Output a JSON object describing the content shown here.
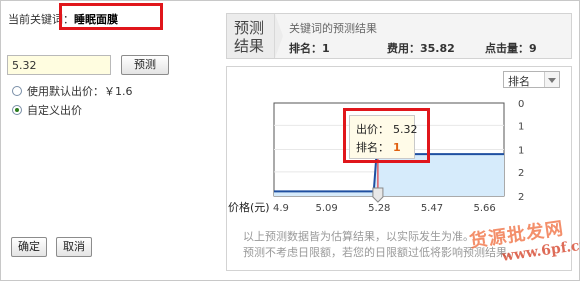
{
  "keyword_label": "当前关键词：",
  "keyword_value": "睡眠面膜",
  "bid": {
    "value": "5.32",
    "predict_button": "预测",
    "default_bid_option": "使用默认出价：￥1.6",
    "custom_bid_option": "自定义出价",
    "selected_option": "custom"
  },
  "actions": {
    "confirm": "确定",
    "cancel": "取消"
  },
  "result": {
    "tab_label_line1": "预测",
    "tab_label_line2": "结果",
    "title": "关键词的预测结果",
    "rank_label": "排名：1",
    "cost_label": "费用：35.82",
    "clicks_label": "点击量：9"
  },
  "chart_select": {
    "selected": "排名"
  },
  "tooltip": {
    "price_label": "出价：",
    "price_value": "5.32",
    "rank_label": "排名：",
    "rank_value": "1"
  },
  "note": {
    "line1": "以上预测数据皆为估算结果，以实际发生为准。",
    "line2": "预测不考虑日限额，若您的日限额过低将影响预测结果。"
  },
  "watermark": {
    "line1": "货源批发网",
    "line2": "www.6pf.cn"
  },
  "colors": {
    "highlight": "#e0161b",
    "line": "#1f4fa0",
    "fill": "#d6ebfb",
    "rank_value": "#e06010"
  },
  "chart_data": {
    "type": "line",
    "xlabel": "价格(元)",
    "x_ticks": [
      "4.9",
      "5.09",
      "5.28",
      "5.47",
      "5.66"
    ],
    "y_ticks": [
      "0",
      "1",
      "1",
      "2",
      "2"
    ],
    "xlim": [
      4.9,
      5.73
    ],
    "ylim": [
      0,
      2
    ],
    "y_inverted": true,
    "series": [
      {
        "x": [
          4.9,
          5.26,
          5.27,
          5.73
        ],
        "y": [
          1.9,
          1.9,
          1.1,
          1.1
        ]
      }
    ],
    "selected_point": {
      "x": 5.32,
      "y": 1
    }
  }
}
